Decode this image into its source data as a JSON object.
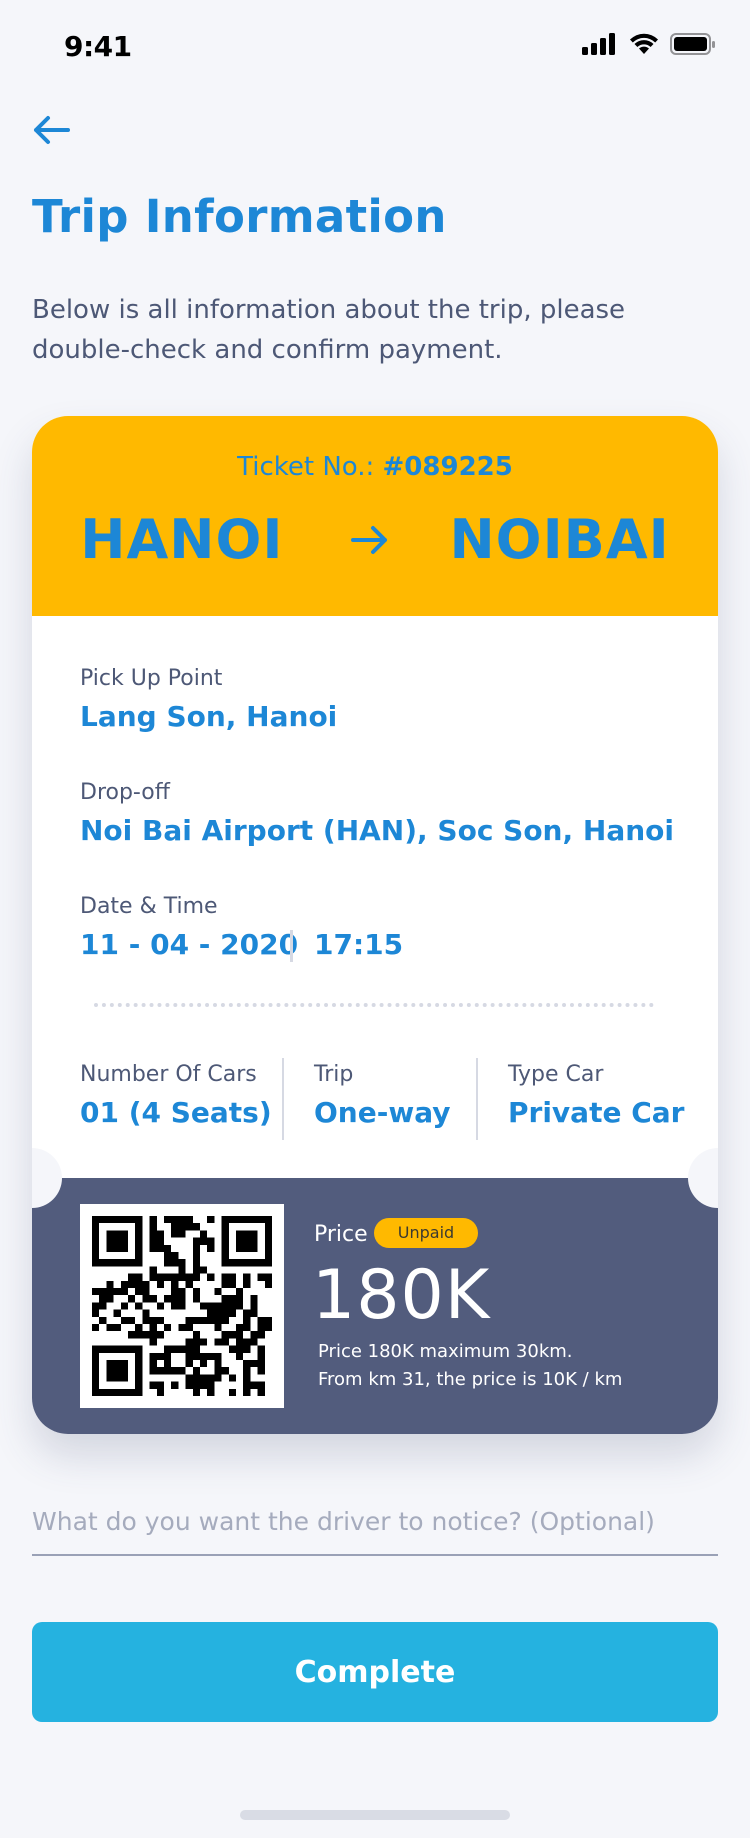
{
  "status_bar": {
    "time": "9:41",
    "icons": [
      "signal-icon",
      "wifi-icon",
      "battery-icon"
    ]
  },
  "header": {
    "back_icon": "arrow-left-icon",
    "title": "Trip Information",
    "subtitle": "Below is all information about the trip, please double-check and confirm payment."
  },
  "ticket": {
    "ticket_no_label": "Ticket No.: ",
    "ticket_no": "#089225",
    "from": "HANOI",
    "to": "NOIBAI",
    "route_icon": "arrow-right-icon",
    "pickup_label": "Pick Up Point",
    "pickup_value": "Lang Son, Hanoi",
    "dropoff_label": "Drop-off",
    "dropoff_value": "Noi Bai Airport (HAN), Soc Son, Hanoi",
    "datetime_label": "Date & Time",
    "date": "11 - 04 - 2020",
    "time": "17:15",
    "cars_label": "Number Of Cars",
    "cars_value": "01 (4 Seats)",
    "trip_label": "Trip",
    "trip_value": "One-way",
    "type_label": "Type Car",
    "type_value": "Private Car",
    "price_label": "Price",
    "payment_status": "Unpaid",
    "price_value": "180K",
    "price_note_1": "Price 180K maximum 30km.",
    "price_note_2": "From km 31, the price is 10K / km"
  },
  "note_input": {
    "placeholder": "What do you want the driver to notice? (Optional)",
    "value": ""
  },
  "complete_button": {
    "label": "Complete"
  },
  "colors": {
    "primary": "#1d87d6",
    "accent_yellow": "#ffb900",
    "ticket_bottom": "#525c7d",
    "button": "#25b2e0",
    "background": "#f5f6fa"
  }
}
